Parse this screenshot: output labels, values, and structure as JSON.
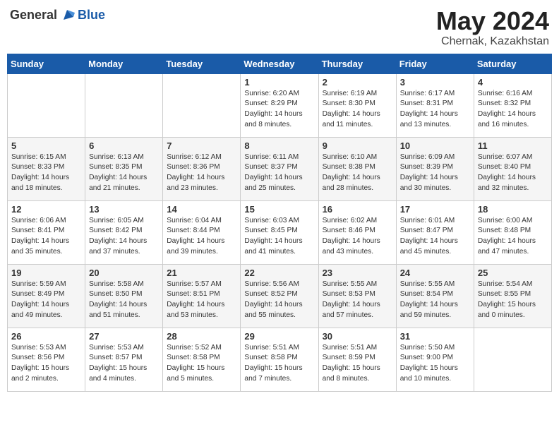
{
  "logo": {
    "general": "General",
    "blue": "Blue"
  },
  "title": {
    "month_year": "May 2024",
    "location": "Chernak, Kazakhstan"
  },
  "headers": [
    "Sunday",
    "Monday",
    "Tuesday",
    "Wednesday",
    "Thursday",
    "Friday",
    "Saturday"
  ],
  "weeks": [
    [
      {
        "day": "",
        "info": ""
      },
      {
        "day": "",
        "info": ""
      },
      {
        "day": "",
        "info": ""
      },
      {
        "day": "1",
        "info": "Sunrise: 6:20 AM\nSunset: 8:29 PM\nDaylight: 14 hours\nand 8 minutes."
      },
      {
        "day": "2",
        "info": "Sunrise: 6:19 AM\nSunset: 8:30 PM\nDaylight: 14 hours\nand 11 minutes."
      },
      {
        "day": "3",
        "info": "Sunrise: 6:17 AM\nSunset: 8:31 PM\nDaylight: 14 hours\nand 13 minutes."
      },
      {
        "day": "4",
        "info": "Sunrise: 6:16 AM\nSunset: 8:32 PM\nDaylight: 14 hours\nand 16 minutes."
      }
    ],
    [
      {
        "day": "5",
        "info": "Sunrise: 6:15 AM\nSunset: 8:33 PM\nDaylight: 14 hours\nand 18 minutes."
      },
      {
        "day": "6",
        "info": "Sunrise: 6:13 AM\nSunset: 8:35 PM\nDaylight: 14 hours\nand 21 minutes."
      },
      {
        "day": "7",
        "info": "Sunrise: 6:12 AM\nSunset: 8:36 PM\nDaylight: 14 hours\nand 23 minutes."
      },
      {
        "day": "8",
        "info": "Sunrise: 6:11 AM\nSunset: 8:37 PM\nDaylight: 14 hours\nand 25 minutes."
      },
      {
        "day": "9",
        "info": "Sunrise: 6:10 AM\nSunset: 8:38 PM\nDaylight: 14 hours\nand 28 minutes."
      },
      {
        "day": "10",
        "info": "Sunrise: 6:09 AM\nSunset: 8:39 PM\nDaylight: 14 hours\nand 30 minutes."
      },
      {
        "day": "11",
        "info": "Sunrise: 6:07 AM\nSunset: 8:40 PM\nDaylight: 14 hours\nand 32 minutes."
      }
    ],
    [
      {
        "day": "12",
        "info": "Sunrise: 6:06 AM\nSunset: 8:41 PM\nDaylight: 14 hours\nand 35 minutes."
      },
      {
        "day": "13",
        "info": "Sunrise: 6:05 AM\nSunset: 8:42 PM\nDaylight: 14 hours\nand 37 minutes."
      },
      {
        "day": "14",
        "info": "Sunrise: 6:04 AM\nSunset: 8:44 PM\nDaylight: 14 hours\nand 39 minutes."
      },
      {
        "day": "15",
        "info": "Sunrise: 6:03 AM\nSunset: 8:45 PM\nDaylight: 14 hours\nand 41 minutes."
      },
      {
        "day": "16",
        "info": "Sunrise: 6:02 AM\nSunset: 8:46 PM\nDaylight: 14 hours\nand 43 minutes."
      },
      {
        "day": "17",
        "info": "Sunrise: 6:01 AM\nSunset: 8:47 PM\nDaylight: 14 hours\nand 45 minutes."
      },
      {
        "day": "18",
        "info": "Sunrise: 6:00 AM\nSunset: 8:48 PM\nDaylight: 14 hours\nand 47 minutes."
      }
    ],
    [
      {
        "day": "19",
        "info": "Sunrise: 5:59 AM\nSunset: 8:49 PM\nDaylight: 14 hours\nand 49 minutes."
      },
      {
        "day": "20",
        "info": "Sunrise: 5:58 AM\nSunset: 8:50 PM\nDaylight: 14 hours\nand 51 minutes."
      },
      {
        "day": "21",
        "info": "Sunrise: 5:57 AM\nSunset: 8:51 PM\nDaylight: 14 hours\nand 53 minutes."
      },
      {
        "day": "22",
        "info": "Sunrise: 5:56 AM\nSunset: 8:52 PM\nDaylight: 14 hours\nand 55 minutes."
      },
      {
        "day": "23",
        "info": "Sunrise: 5:55 AM\nSunset: 8:53 PM\nDaylight: 14 hours\nand 57 minutes."
      },
      {
        "day": "24",
        "info": "Sunrise: 5:55 AM\nSunset: 8:54 PM\nDaylight: 14 hours\nand 59 minutes."
      },
      {
        "day": "25",
        "info": "Sunrise: 5:54 AM\nSunset: 8:55 PM\nDaylight: 15 hours\nand 0 minutes."
      }
    ],
    [
      {
        "day": "26",
        "info": "Sunrise: 5:53 AM\nSunset: 8:56 PM\nDaylight: 15 hours\nand 2 minutes."
      },
      {
        "day": "27",
        "info": "Sunrise: 5:53 AM\nSunset: 8:57 PM\nDaylight: 15 hours\nand 4 minutes."
      },
      {
        "day": "28",
        "info": "Sunrise: 5:52 AM\nSunset: 8:58 PM\nDaylight: 15 hours\nand 5 minutes."
      },
      {
        "day": "29",
        "info": "Sunrise: 5:51 AM\nSunset: 8:58 PM\nDaylight: 15 hours\nand 7 minutes."
      },
      {
        "day": "30",
        "info": "Sunrise: 5:51 AM\nSunset: 8:59 PM\nDaylight: 15 hours\nand 8 minutes."
      },
      {
        "day": "31",
        "info": "Sunrise: 5:50 AM\nSunset: 9:00 PM\nDaylight: 15 hours\nand 10 minutes."
      },
      {
        "day": "",
        "info": ""
      }
    ]
  ]
}
